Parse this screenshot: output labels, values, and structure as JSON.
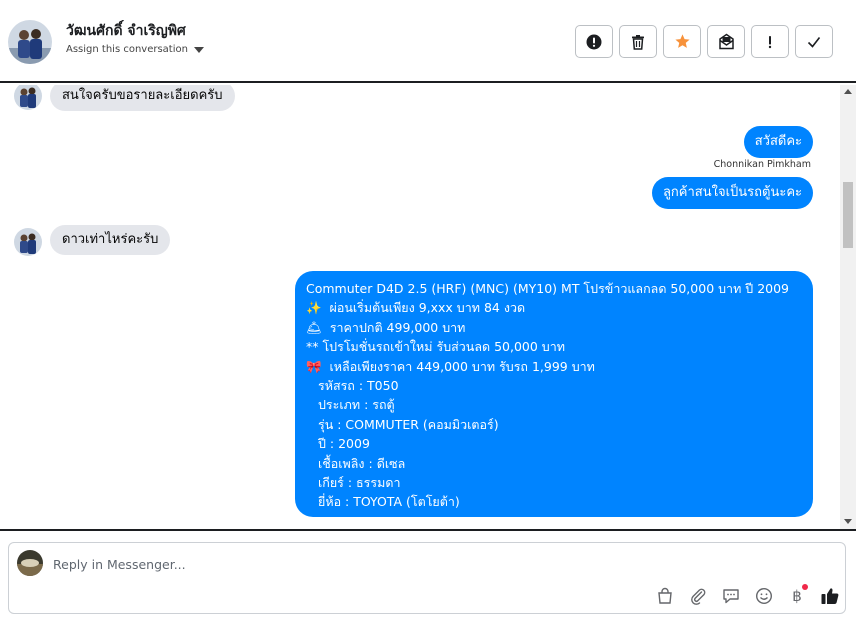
{
  "header": {
    "contact_name": "วัฒนศักดิ์ จำเริญพิศ",
    "assign_label": "Assign this conversation",
    "actions": [
      {
        "name": "spam-button",
        "icon": "exclamation-circle-icon"
      },
      {
        "name": "delete-button",
        "icon": "trash-icon"
      },
      {
        "name": "star-button",
        "icon": "star-icon"
      },
      {
        "name": "mark-unread-button",
        "icon": "envelope-icon"
      },
      {
        "name": "follow-up-button",
        "icon": "exclamation-icon"
      },
      {
        "name": "done-button",
        "icon": "checkmark-icon"
      }
    ]
  },
  "thread": {
    "messages": [
      {
        "direction": "in",
        "text": "สนใจครับขอรายละเอียดครับ"
      },
      {
        "direction": "out",
        "text": "สวัสดีคะ",
        "sender": "Chonnikan Pimkham"
      },
      {
        "direction": "out",
        "text": "ลูกค้าสนใจเป็นรถตู้นะคะ"
      },
      {
        "direction": "in",
        "text": "ดาวเท่าไหร่คะรับ"
      }
    ],
    "listing": {
      "title": "Commuter D4D 2.5 (HRF) (MNC) (MY10) MT โปรข้าวแลกลด 50,000 บาท ปี 2009",
      "sparkle_emoji": "✨",
      "installment": "ผ่อนเริ่มต้นเพียง 9,xxx บาท  84 งวด",
      "bell_emoji": "🛎",
      "normal_price": "ราคาปกติ 499,000 บาท",
      "promo": "** โปรโมชั่นรถเข้าใหม่ รับส่วนลด 50,000 บาท",
      "ribbon_emoji": "🎀",
      "special_price": "เหลือเพียงราคา 449,000 บาท รับรถ 1,999 บาท",
      "code": "รหัสรถ : T050",
      "type": "ประเภท : รถตู้",
      "model": "รุ่น : COMMUTER (คอมมิวเตอร์)",
      "year": "ปี : 2009",
      "fuel": "เชื้อเพลิง : ดีเซล",
      "gear": "เกียร์ : ธรรมดา",
      "brand": "ยี่ห้อ : TOYOTA (โตโยต้า)"
    }
  },
  "composer": {
    "placeholder": "Reply in Messenger...",
    "tools": [
      "shopping-bag-icon",
      "paperclip-icon",
      "saved-reply-icon",
      "emoji-icon",
      "baht-payment-icon",
      "like-icon"
    ],
    "baht_symbol": "฿"
  },
  "colors": {
    "outgoing_bubble": "#0084ff",
    "incoming_bubble": "#e4e6eb",
    "star": "#f7923b"
  }
}
